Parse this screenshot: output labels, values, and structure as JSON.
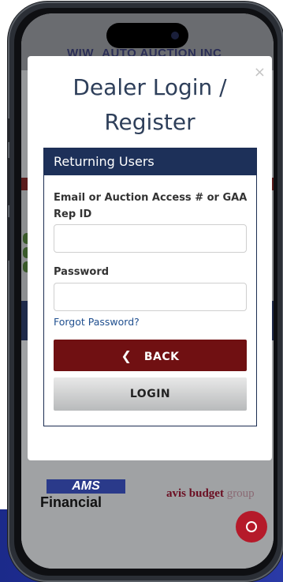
{
  "site": {
    "header_logo_text": "AUTO AUCTION INC",
    "header_logo_mark": "WIW"
  },
  "modal": {
    "title_line1": "Dealer Login /",
    "title_line2": "Register",
    "close_label": "×"
  },
  "panel": {
    "heading": "Returning Users",
    "email_label": "Email or Auction Access # or GAA Rep ID",
    "email_value": "",
    "password_label": "Password",
    "password_value": "",
    "forgot_link": "Forgot Password?",
    "back_button": "BACK",
    "login_button": "LOGIN"
  },
  "sponsors": {
    "ams_top": "AMS",
    "ams_bottom": "Financial",
    "avis_brand": "avis budget",
    "avis_group": "group"
  },
  "icons": {
    "back_chevron": "chevron-left-icon",
    "chat": "chat-bubble-icon",
    "close": "close-icon"
  },
  "colors": {
    "header_navy": "#1d3059",
    "back_red": "#701012",
    "chat_red": "#b51a2a",
    "title_blue": "#2e3f5a"
  }
}
